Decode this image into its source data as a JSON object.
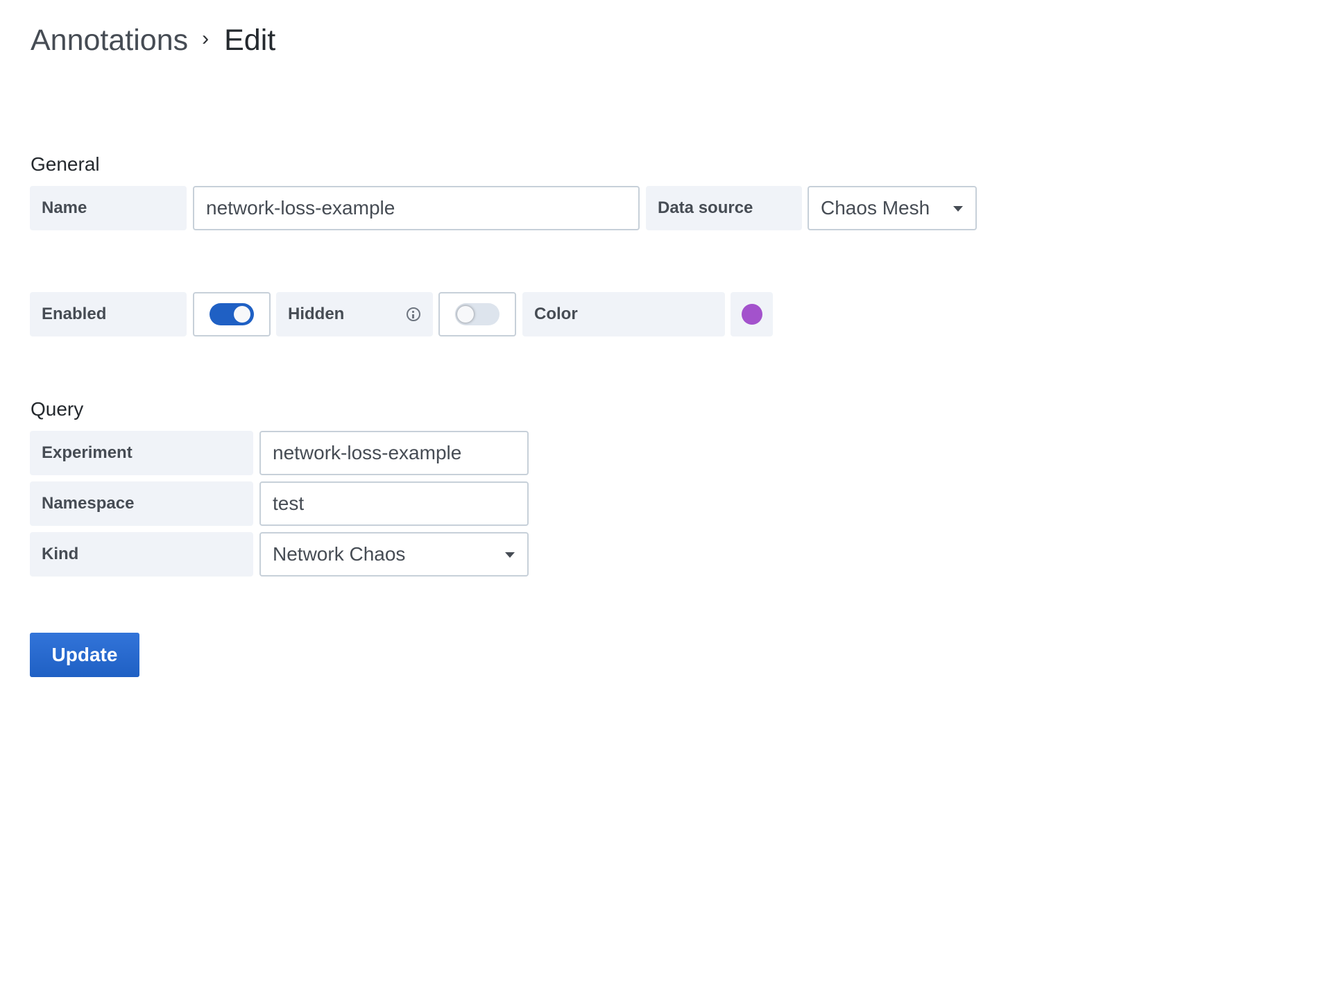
{
  "breadcrumb": {
    "parent": "Annotations",
    "separator": "›",
    "current": "Edit"
  },
  "general": {
    "heading": "General",
    "name_label": "Name",
    "name_value": "network-loss-example",
    "datasource_label": "Data source",
    "datasource_value": "Chaos Mesh",
    "enabled_label": "Enabled",
    "enabled": true,
    "hidden_label": "Hidden",
    "hidden": false,
    "color_label": "Color",
    "color_value": "#a352cc"
  },
  "query": {
    "heading": "Query",
    "experiment_label": "Experiment",
    "experiment_value": "network-loss-example",
    "namespace_label": "Namespace",
    "namespace_value": "test",
    "kind_label": "Kind",
    "kind_value": "Network Chaos"
  },
  "actions": {
    "update_label": "Update"
  },
  "icons": {
    "breadcrumb_separator": "chevron-right-icon",
    "hidden_info": "info-circle-icon",
    "select_caret": "caret-down-icon"
  },
  "colors": {
    "primary": "#1f60c4",
    "label_bg": "#f0f3f8",
    "border": "#c7d0d9",
    "annotation_color": "#a352cc"
  }
}
